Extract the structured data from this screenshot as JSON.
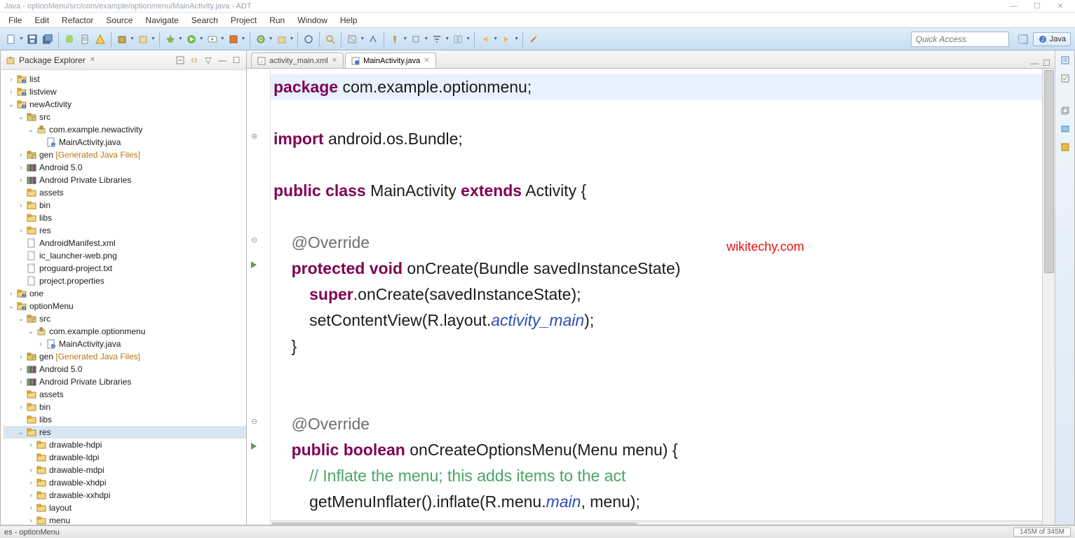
{
  "title": "Java - optionMenu/src/com/example/optionmenu/MainActivity.java - ADT",
  "menu": [
    "File",
    "Edit",
    "Refactor",
    "Source",
    "Navigate",
    "Search",
    "Project",
    "Run",
    "Window",
    "Help"
  ],
  "quick_access_placeholder": "Quick Access",
  "perspective_label": "Java",
  "package_explorer": {
    "title": "Package Explorer"
  },
  "tree": [
    {
      "ind": 0,
      "tw": ">",
      "icon": "project",
      "label": "list"
    },
    {
      "ind": 0,
      "tw": ">",
      "icon": "project",
      "label": "listview"
    },
    {
      "ind": 0,
      "tw": "v",
      "icon": "project",
      "label": "newActivity"
    },
    {
      "ind": 1,
      "tw": "v",
      "icon": "src",
      "label": "src"
    },
    {
      "ind": 2,
      "tw": "v",
      "icon": "package",
      "label": "com.example.newactivity"
    },
    {
      "ind": 3,
      "tw": "",
      "icon": "java",
      "label": "MainActivity.java"
    },
    {
      "ind": 1,
      "tw": ">",
      "icon": "src",
      "label": "gen",
      "gen": " [Generated Java Files]"
    },
    {
      "ind": 1,
      "tw": ">",
      "icon": "lib",
      "label": "Android 5.0"
    },
    {
      "ind": 1,
      "tw": ">",
      "icon": "lib",
      "label": "Android Private Libraries"
    },
    {
      "ind": 1,
      "tw": "",
      "icon": "folder",
      "label": "assets"
    },
    {
      "ind": 1,
      "tw": ">",
      "icon": "folder",
      "label": "bin"
    },
    {
      "ind": 1,
      "tw": "",
      "icon": "folder",
      "label": "libs"
    },
    {
      "ind": 1,
      "tw": ">",
      "icon": "folder",
      "label": "res"
    },
    {
      "ind": 1,
      "tw": "",
      "icon": "file",
      "label": "AndroidManifest.xml"
    },
    {
      "ind": 1,
      "tw": "",
      "icon": "file",
      "label": "ic_launcher-web.png"
    },
    {
      "ind": 1,
      "tw": "",
      "icon": "file",
      "label": "proguard-project.txt"
    },
    {
      "ind": 1,
      "tw": "",
      "icon": "file",
      "label": "project.properties"
    },
    {
      "ind": 0,
      "tw": ">",
      "icon": "project",
      "label": "one"
    },
    {
      "ind": 0,
      "tw": "v",
      "icon": "project",
      "label": "optionMenu"
    },
    {
      "ind": 1,
      "tw": "v",
      "icon": "src",
      "label": "src"
    },
    {
      "ind": 2,
      "tw": "v",
      "icon": "package",
      "label": "com.example.optionmenu"
    },
    {
      "ind": 3,
      "tw": ">",
      "icon": "java",
      "label": "MainActivity.java"
    },
    {
      "ind": 1,
      "tw": ">",
      "icon": "src",
      "label": "gen",
      "gen": " [Generated Java Files]"
    },
    {
      "ind": 1,
      "tw": ">",
      "icon": "lib",
      "label": "Android 5.0"
    },
    {
      "ind": 1,
      "tw": ">",
      "icon": "lib",
      "label": "Android Private Libraries"
    },
    {
      "ind": 1,
      "tw": "",
      "icon": "folder",
      "label": "assets"
    },
    {
      "ind": 1,
      "tw": ">",
      "icon": "folder",
      "label": "bin"
    },
    {
      "ind": 1,
      "tw": "",
      "icon": "folder",
      "label": "libs"
    },
    {
      "ind": 1,
      "tw": "v",
      "icon": "folder",
      "label": "res",
      "sel": true
    },
    {
      "ind": 2,
      "tw": ">",
      "icon": "folder",
      "label": "drawable-hdpi"
    },
    {
      "ind": 2,
      "tw": "",
      "icon": "folder",
      "label": "drawable-ldpi"
    },
    {
      "ind": 2,
      "tw": ">",
      "icon": "folder",
      "label": "drawable-mdpi"
    },
    {
      "ind": 2,
      "tw": ">",
      "icon": "folder",
      "label": "drawable-xhdpi"
    },
    {
      "ind": 2,
      "tw": ">",
      "icon": "folder",
      "label": "drawable-xxhdpi"
    },
    {
      "ind": 2,
      "tw": ">",
      "icon": "folder",
      "label": "layout"
    },
    {
      "ind": 2,
      "tw": ">",
      "icon": "folder",
      "label": "menu"
    }
  ],
  "editor_tabs": [
    {
      "label": "activity_main.xml",
      "active": false
    },
    {
      "label": "MainActivity.java",
      "active": true
    }
  ],
  "watermark": "wikitechy.com",
  "code_lines": [
    {
      "type": "hl",
      "html": "<span class='kw'>package</span> com.example.optionmenu;"
    },
    {
      "html": ""
    },
    {
      "mark": "⊕",
      "html": "<span class='kw'>import</span> android.os.Bundle;"
    },
    {
      "html": ""
    },
    {
      "html": "<span class='kw'>public</span> <span class='kw'>class</span> MainActivity <span class='kw'>extends</span> Activity {"
    },
    {
      "html": ""
    },
    {
      "mark": "⊖",
      "html": "    <span class='ann'>@Override</span>"
    },
    {
      "mark": "▶",
      "html": "    <span class='kw'>protected</span> <span class='kw'>void</span> onCreate(Bundle savedInstanceState)"
    },
    {
      "html": "        <span class='kw'>super</span>.onCreate(savedInstanceState);"
    },
    {
      "html": "        setContentView(R.layout.<span class='it'>activity_main</span>);"
    },
    {
      "html": "    }"
    },
    {
      "html": ""
    },
    {
      "html": ""
    },
    {
      "mark": "⊖",
      "html": "    <span class='ann'>@Override</span>"
    },
    {
      "mark": "▶",
      "html": "    <span class='kw'>public</span> <span class='kw'>boolean</span> onCreateOptionsMenu(Menu menu) {"
    },
    {
      "html": "        <span class='cm'>// Inflate the menu; this adds items to the act</span>"
    },
    {
      "html": "        getMenuInflater().inflate(R.menu.<span class='it'>main</span>, menu);"
    }
  ],
  "status_left": "es - optionMenu",
  "heap": "145M of 345M"
}
